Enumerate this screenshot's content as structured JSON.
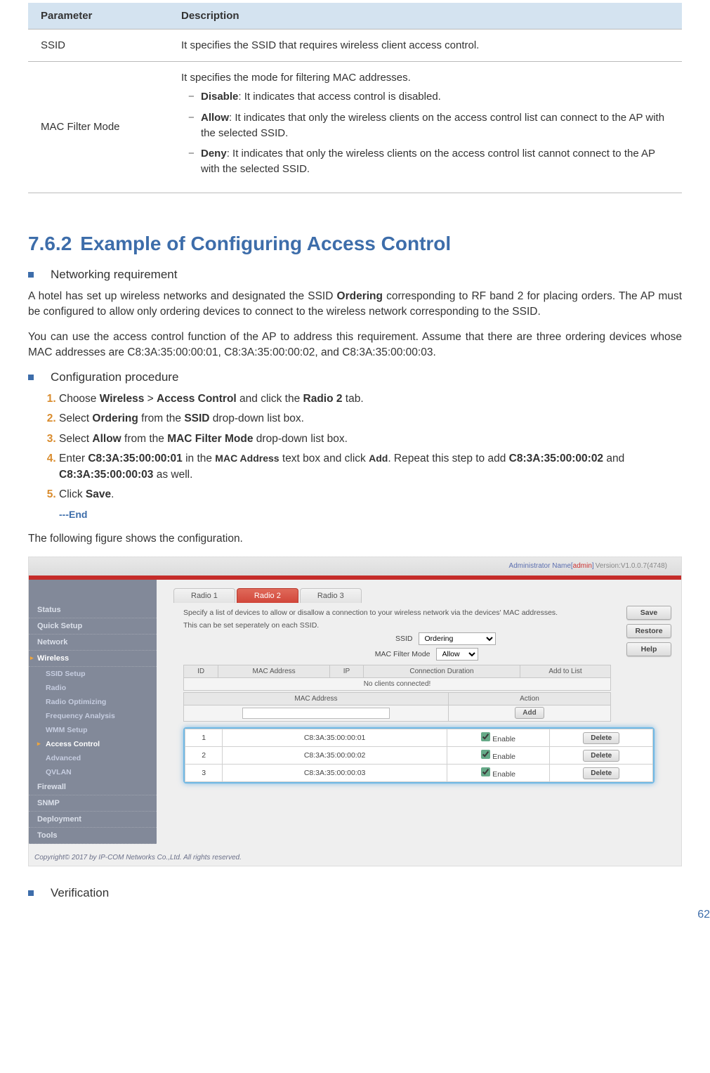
{
  "param_table": {
    "header_param": "Parameter",
    "header_desc": "Description",
    "rows": [
      {
        "param": "SSID",
        "desc": "It specifies the SSID that requires wireless client access control."
      },
      {
        "param": "MAC Filter Mode",
        "desc_intro": "It specifies the mode for filtering MAC addresses.",
        "items": [
          {
            "bold": "Disable",
            "rest": ": It indicates that access control is disabled."
          },
          {
            "bold": "Allow",
            "rest": ": It indicates that only the wireless clients on the access control list can connect to the AP with the selected SSID."
          },
          {
            "bold": "Deny",
            "rest": ": It indicates that only the wireless clients on the access control list cannot connect to the AP with the selected SSID."
          }
        ]
      }
    ]
  },
  "section": {
    "num": "7.6.2",
    "title": "Example of Configuring Access Control"
  },
  "sq1": "Networking requirement",
  "para1a": "A hotel has set up wireless networks and designated the SSID ",
  "para1b": "Ordering",
  "para1c": " corresponding to RF band 2 for placing orders. The AP must be configured to allow only ordering devices to connect to the wireless network corresponding to the SSID.",
  "para2": "You can use the access control function of the AP to address this requirement. Assume that there are three ordering devices whose MAC addresses are C8:3A:35:00:00:01, C8:3A:35:00:00:02, and C8:3A:35:00:00:03.",
  "sq2": "Configuration procedure",
  "steps": {
    "s1": {
      "a": "Choose ",
      "b": "Wireless",
      "c": " > ",
      "d": "Access Control",
      "e": " and click the ",
      "f": "Radio 2",
      "g": " tab."
    },
    "s2": {
      "a": "Select ",
      "b": "Ordering",
      "c": " from the ",
      "d": "SSID",
      "e": " drop-down list box."
    },
    "s3": {
      "a": "Select ",
      "b": "Allow",
      "c": " from the ",
      "d": "MAC Filter Mode",
      "e": " drop-down list box."
    },
    "s4": {
      "a": "Enter ",
      "b": "C8:3A:35:00:00:01",
      "c": " in the ",
      "d": "MAC Address",
      "e": " text box and click ",
      "f": "Add",
      "g": ". Repeat this step to add ",
      "h": "C8:3A:35:00:00:02",
      "i": " and ",
      "j": "C8:3A:35:00:00:03",
      "k": " as well."
    },
    "s5": {
      "a": "Click ",
      "b": "Save",
      "c": "."
    }
  },
  "end": "---End",
  "para3": "The following figure shows the configuration.",
  "sq3": "Verification",
  "pagenum": "62",
  "ui": {
    "admin_label": "Administrator Name[",
    "admin_name": "admin",
    "admin_close": "]",
    "version": "Version:V1.0.0.7(4748)",
    "side": {
      "status": "Status",
      "quick": "Quick Setup",
      "network": "Network",
      "wireless": "Wireless",
      "ssid": "SSID Setup",
      "radio": "Radio",
      "opt": "Radio Optimizing",
      "freq": "Frequency Analysis",
      "wmm": "WMM Setup",
      "ac": "Access Control",
      "adv": "Advanced",
      "qvlan": "QVLAN",
      "firewall": "Firewall",
      "snmp": "SNMP",
      "deploy": "Deployment",
      "tools": "Tools"
    },
    "tabs": {
      "r1": "Radio 1",
      "r2": "Radio 2",
      "r3": "Radio 3"
    },
    "desc1": "Specify a list of devices to allow or disallow a connection to your wireless network via the devices' MAC addresses.",
    "desc2": "This can be set seperately on each SSID.",
    "labels": {
      "ssid": "SSID",
      "mode": "MAC Filter Mode"
    },
    "ssid_value": "Ordering",
    "mode_value": "Allow",
    "buttons": {
      "save": "Save",
      "restore": "Restore",
      "help": "Help",
      "add": "Add",
      "delete": "Delete"
    },
    "tbl1": {
      "id": "ID",
      "mac": "MAC Address",
      "ip": "IP",
      "dur": "Connection Duration",
      "add": "Add to List",
      "empty": "No clients connected!"
    },
    "tbl2": {
      "mac": "MAC Address",
      "action": "Action",
      "enable": "Enable"
    },
    "rows": [
      {
        "n": "1",
        "mac": "C8:3A:35:00:00:01"
      },
      {
        "n": "2",
        "mac": "C8:3A:35:00:00:02"
      },
      {
        "n": "3",
        "mac": "C8:3A:35:00:00:03"
      }
    ],
    "copyright": "Copyright© 2017 by IP-COM Networks Co.,Ltd. All rights reserved."
  }
}
